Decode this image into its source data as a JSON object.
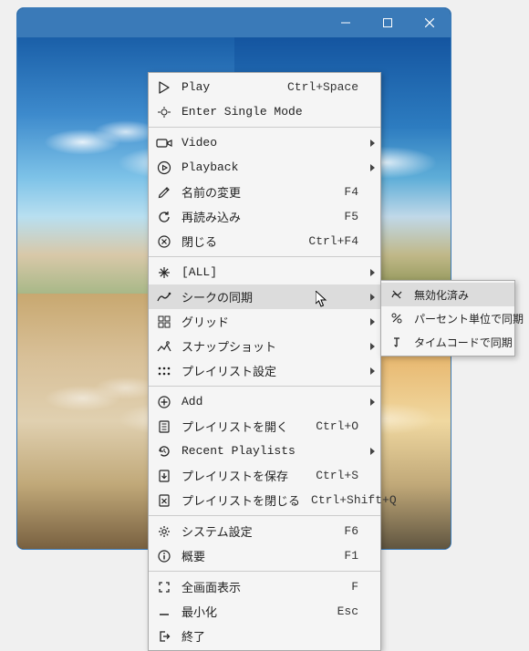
{
  "titlebar": {
    "minimize": "minimize",
    "maximize": "maximize",
    "close": "close"
  },
  "menu": {
    "items": [
      {
        "icon": "play-icon",
        "label": "Play",
        "shortcut": "Ctrl+Space",
        "submenu": false
      },
      {
        "icon": "single-mode-icon",
        "label": "Enter Single Mode",
        "shortcut": "",
        "submenu": false
      },
      {
        "sep": true
      },
      {
        "icon": "video-icon",
        "label": "Video",
        "shortcut": "",
        "submenu": true
      },
      {
        "icon": "playback-icon",
        "label": "Playback",
        "shortcut": "",
        "submenu": true
      },
      {
        "icon": "rename-icon",
        "label": "名前の変更",
        "shortcut": "F4",
        "submenu": false
      },
      {
        "icon": "reload-icon",
        "label": "再読み込み",
        "shortcut": "F5",
        "submenu": false
      },
      {
        "icon": "close-icon",
        "label": "閉じる",
        "shortcut": "Ctrl+F4",
        "submenu": false
      },
      {
        "sep": true
      },
      {
        "icon": "all-icon",
        "label": "[ALL]",
        "shortcut": "",
        "submenu": true
      },
      {
        "icon": "sync-seek-icon",
        "label": "シークの同期",
        "shortcut": "",
        "submenu": true,
        "hovered": true
      },
      {
        "icon": "grid-icon",
        "label": "グリッド",
        "shortcut": "",
        "submenu": true
      },
      {
        "icon": "snapshot-icon",
        "label": "スナップショット",
        "shortcut": "",
        "submenu": true
      },
      {
        "icon": "playlist-settings-icon",
        "label": "プレイリスト設定",
        "shortcut": "",
        "submenu": true
      },
      {
        "sep": true
      },
      {
        "icon": "add-icon",
        "label": "Add",
        "shortcut": "",
        "submenu": true
      },
      {
        "icon": "open-playlist-icon",
        "label": "プレイリストを開く",
        "shortcut": "Ctrl+O",
        "submenu": false
      },
      {
        "icon": "recent-icon",
        "label": "Recent Playlists",
        "shortcut": "",
        "submenu": true
      },
      {
        "icon": "save-playlist-icon",
        "label": "プレイリストを保存",
        "shortcut": "Ctrl+S",
        "submenu": false
      },
      {
        "icon": "close-playlist-icon",
        "label": "プレイリストを閉じる",
        "shortcut": "Ctrl+Shift+Q",
        "submenu": false
      },
      {
        "sep": true
      },
      {
        "icon": "settings-icon",
        "label": "システム設定",
        "shortcut": "F6",
        "submenu": false
      },
      {
        "icon": "about-icon",
        "label": "概要",
        "shortcut": "F1",
        "submenu": false
      },
      {
        "sep": true
      },
      {
        "icon": "fullscreen-icon",
        "label": "全画面表示",
        "shortcut": "F",
        "submenu": false
      },
      {
        "icon": "minimize-icon",
        "label": "最小化",
        "shortcut": "Esc",
        "submenu": false
      },
      {
        "icon": "exit-icon",
        "label": "終了",
        "shortcut": "",
        "submenu": false
      }
    ]
  },
  "submenu": {
    "items": [
      {
        "icon": "disabled-icon",
        "label": "無効化済み",
        "hovered": true
      },
      {
        "icon": "percent-icon",
        "label": "パーセント単位で同期"
      },
      {
        "icon": "timecode-icon",
        "label": "タイムコードで同期"
      }
    ]
  }
}
